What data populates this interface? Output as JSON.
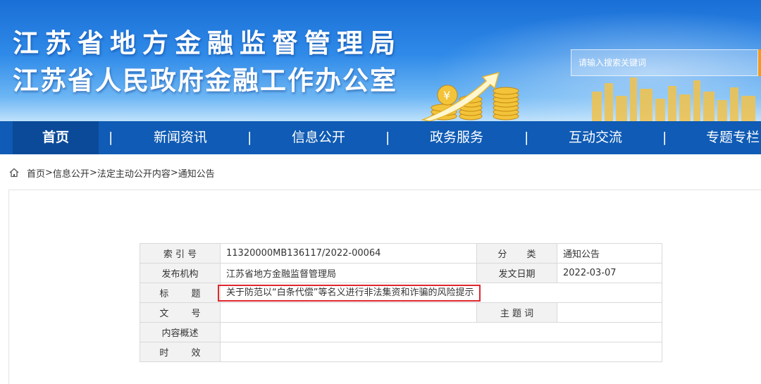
{
  "header": {
    "title_line1": "江苏省地方金融监督管理局",
    "title_line2": "江苏省人民政府金融工作办公室",
    "search_placeholder": "请输入搜索关键词"
  },
  "nav": {
    "items": [
      "首页",
      "新闻资讯",
      "信息公开",
      "政务服务",
      "互动交流",
      "专题专栏"
    ],
    "separator": "|",
    "active_index": 0
  },
  "breadcrumb": {
    "items": [
      "首页",
      "信息公开",
      "法定主动公开内容",
      "通知公告"
    ],
    "separator": ">"
  },
  "meta": {
    "index_label": "索 引 号",
    "index_value": "11320000MB136117/2022-00064",
    "category_label": "分 类",
    "category_value": "通知公告",
    "publisher_label": "发布机构",
    "publisher_value": "江苏省地方金融监督管理局",
    "date_label": "发文日期",
    "date_value": "2022-03-07",
    "title_label": "标 题",
    "title_value": "关于防范以“白条代偿”等名义进行非法集资和诈骗的风险提示",
    "docno_label": "文 号",
    "docno_value": "",
    "keywords_label": "主 题 词",
    "keywords_value": "",
    "summary_label": "内容概述",
    "summary_value": "",
    "validity_label": "时 效",
    "validity_value": ""
  },
  "colors": {
    "nav_bg": "#0f5bb5",
    "highlight_border": "#e0282e",
    "search_button": "#f39a1e"
  }
}
